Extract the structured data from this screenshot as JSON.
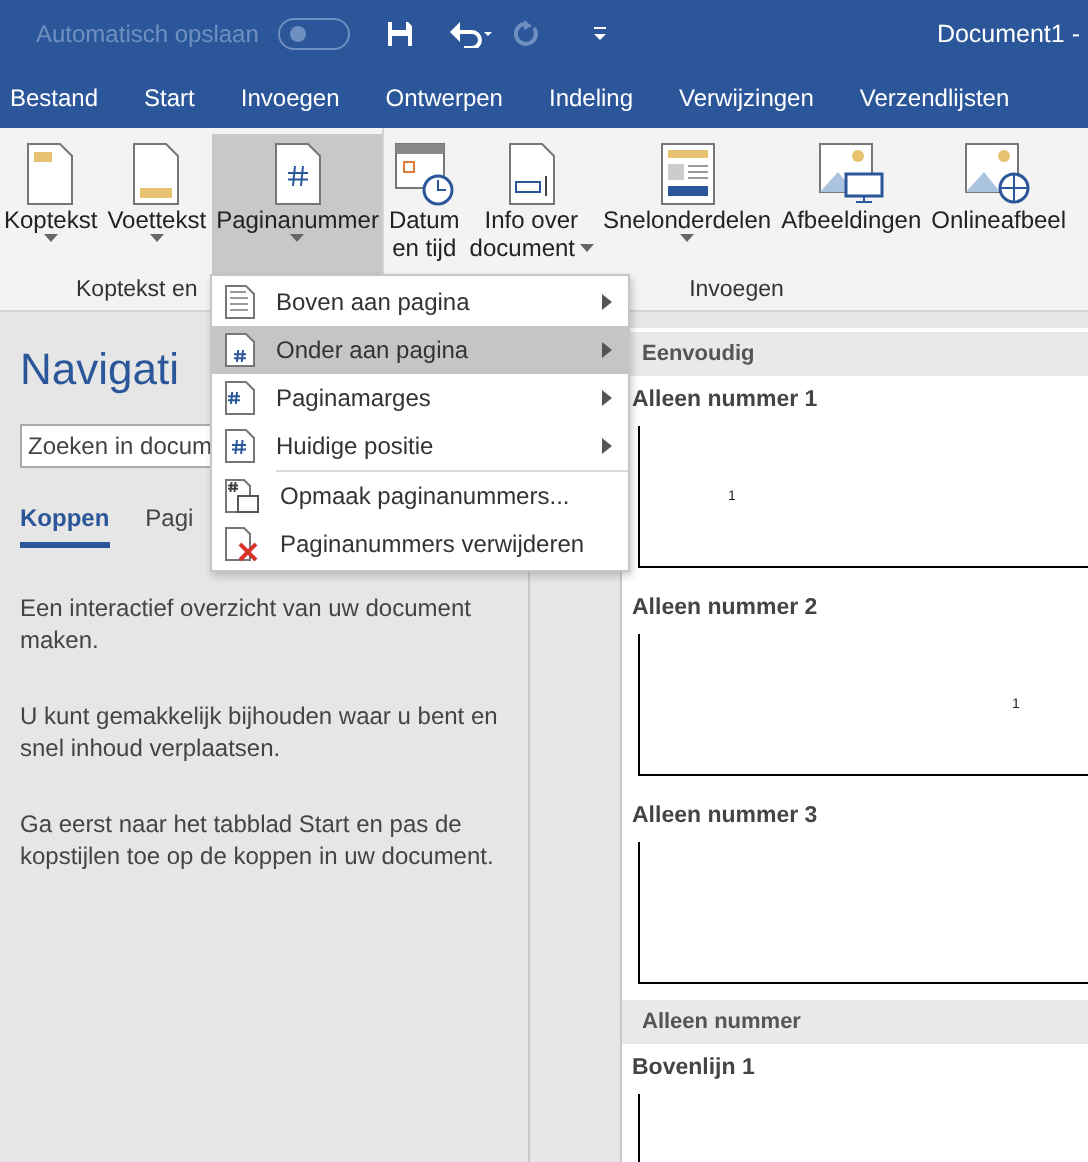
{
  "title_bar": {
    "autosave_label": "Automatisch opslaan",
    "autosave_on": false,
    "document_title": "Document1  -"
  },
  "menu_tabs": [
    {
      "label": "Bestand"
    },
    {
      "label": "Start"
    },
    {
      "label": "Invoegen"
    },
    {
      "label": "Ontwerpen"
    },
    {
      "label": "Indeling"
    },
    {
      "label": "Verwijzingen"
    },
    {
      "label": "Verzendlijsten"
    }
  ],
  "ribbon": {
    "groups": [
      {
        "label": "Koptekst en",
        "buttons": [
          {
            "kind": "header",
            "label": [
              "Koptekst"
            ],
            "has_menu": true,
            "selected": false
          },
          {
            "kind": "footer",
            "label": [
              "Voettekst"
            ],
            "has_menu": true,
            "selected": false
          },
          {
            "kind": "pagenumber",
            "label": [
              "Paginanummer"
            ],
            "has_menu": true,
            "selected": true
          }
        ]
      },
      {
        "label": "Invoegen",
        "buttons": [
          {
            "kind": "date",
            "label": [
              "Datum",
              "en tijd"
            ],
            "has_menu": false,
            "selected": false
          },
          {
            "kind": "docinfo",
            "label": [
              "Info over",
              "document"
            ],
            "has_menu": true,
            "selected": false
          },
          {
            "kind": "parts",
            "label": [
              "Snelonderdelen"
            ],
            "has_menu": true,
            "selected": false
          },
          {
            "kind": "pictures",
            "label": [
              "Afbeeldingen"
            ],
            "has_menu": false,
            "selected": false
          },
          {
            "kind": "online",
            "label": [
              "Onlineafbeel"
            ],
            "has_menu": false,
            "selected": false
          }
        ]
      }
    ]
  },
  "navigation": {
    "title": "Navigati",
    "search_placeholder": "Zoeken in docum",
    "tabs": [
      {
        "label": "Koppen",
        "selected": true
      },
      {
        "label": "Pagi",
        "selected": false
      }
    ],
    "paragraphs": [
      "Een interactief overzicht van uw document maken.",
      "U kunt gemakkelijk bijhouden waar u bent en snel inhoud verplaatsen.",
      "Ga eerst naar het tabblad Start en pas de kopstijlen toe op de koppen in uw document."
    ]
  },
  "dropdown_menu": [
    {
      "kind": "top",
      "label": "Boven aan pagina",
      "submenu": true,
      "selected": false
    },
    {
      "kind": "bottom",
      "label": "Onder aan pagina",
      "submenu": true,
      "selected": true
    },
    {
      "kind": "margins",
      "label": "Paginamarges",
      "submenu": true,
      "selected": false
    },
    {
      "kind": "current",
      "label": "Huidige positie",
      "submenu": true,
      "selected": false
    },
    {
      "kind": "format",
      "label": "Opmaak paginanummers...",
      "submenu": false,
      "selected": false
    },
    {
      "kind": "remove",
      "label": "Paginanummers verwijderen",
      "submenu": false,
      "selected": false
    }
  ],
  "gallery": {
    "sections": [
      {
        "title": "Eenvoudig",
        "items": [
          {
            "title": "Alleen nummer 1",
            "kind": "number-left",
            "number": "1"
          },
          {
            "title": "Alleen nummer 2",
            "kind": "number-center",
            "number": "1"
          },
          {
            "title": "Alleen nummer 3",
            "kind": "blank"
          }
        ]
      },
      {
        "title": "Alleen nummer",
        "items": [
          {
            "title": "Bovenlijn 1",
            "kind": "blank"
          }
        ]
      }
    ]
  }
}
